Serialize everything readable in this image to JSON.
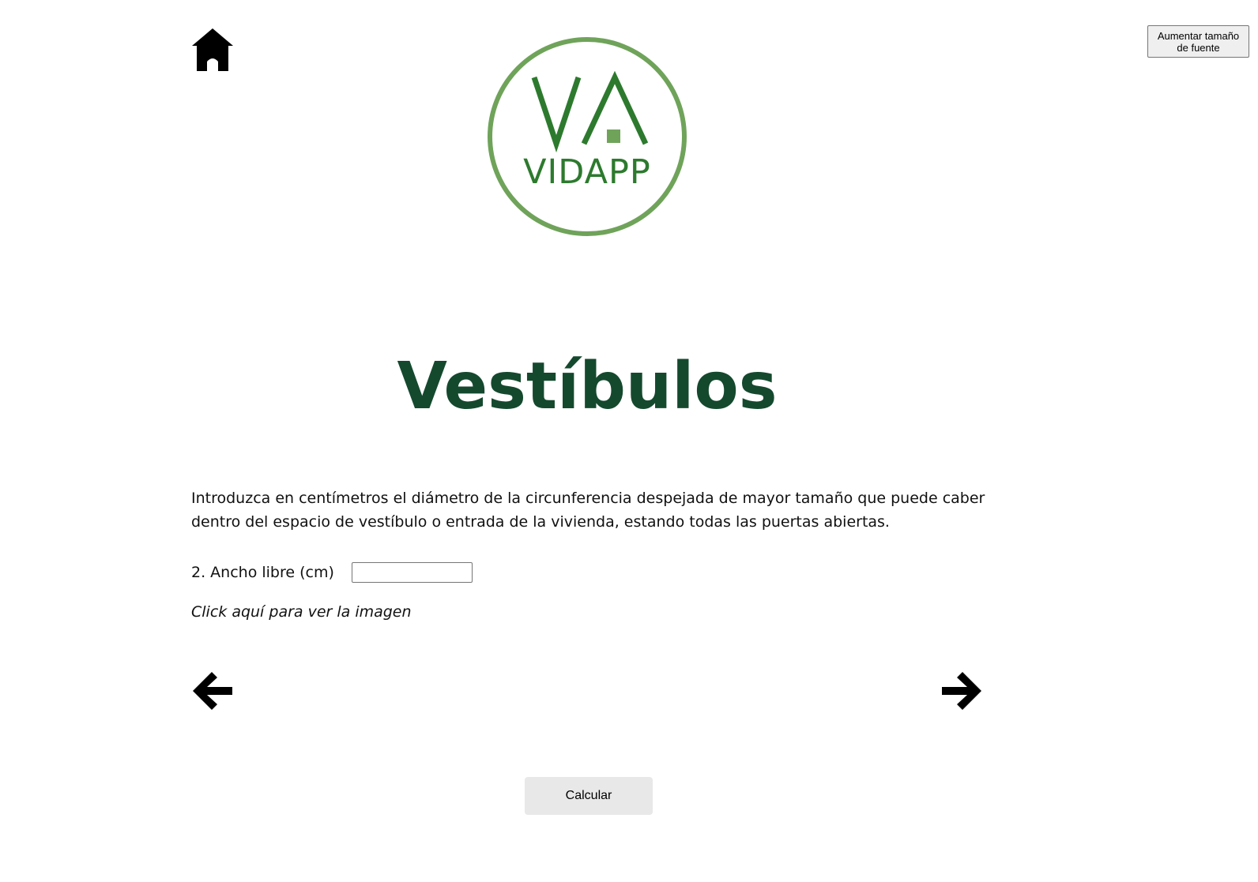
{
  "header": {
    "home_icon": "home-icon",
    "font_button_label": "Aumentar tamaño de fuente"
  },
  "logo": {
    "monogram": "VA",
    "text": "VIDAPP",
    "ring_color": "#6fa35a",
    "text_color": "#2d7a2e"
  },
  "page": {
    "title": "Vestíbulos",
    "title_color": "#14492e",
    "description": "Introduzca en centímetros el diámetro de la circunferencia despejada de mayor tamaño que puede caber dentro del espacio de vestíbulo o entrada de la vivienda, estando todas las puertas abiertas."
  },
  "form": {
    "field_label": "2. Ancho libre (cm)",
    "field_value": "",
    "field_placeholder": "",
    "image_link": "Click aquí para ver la imagen"
  },
  "nav": {
    "prev_icon": "arrow-left-icon",
    "next_icon": "arrow-right-icon"
  },
  "actions": {
    "calculate_label": "Calcular"
  }
}
